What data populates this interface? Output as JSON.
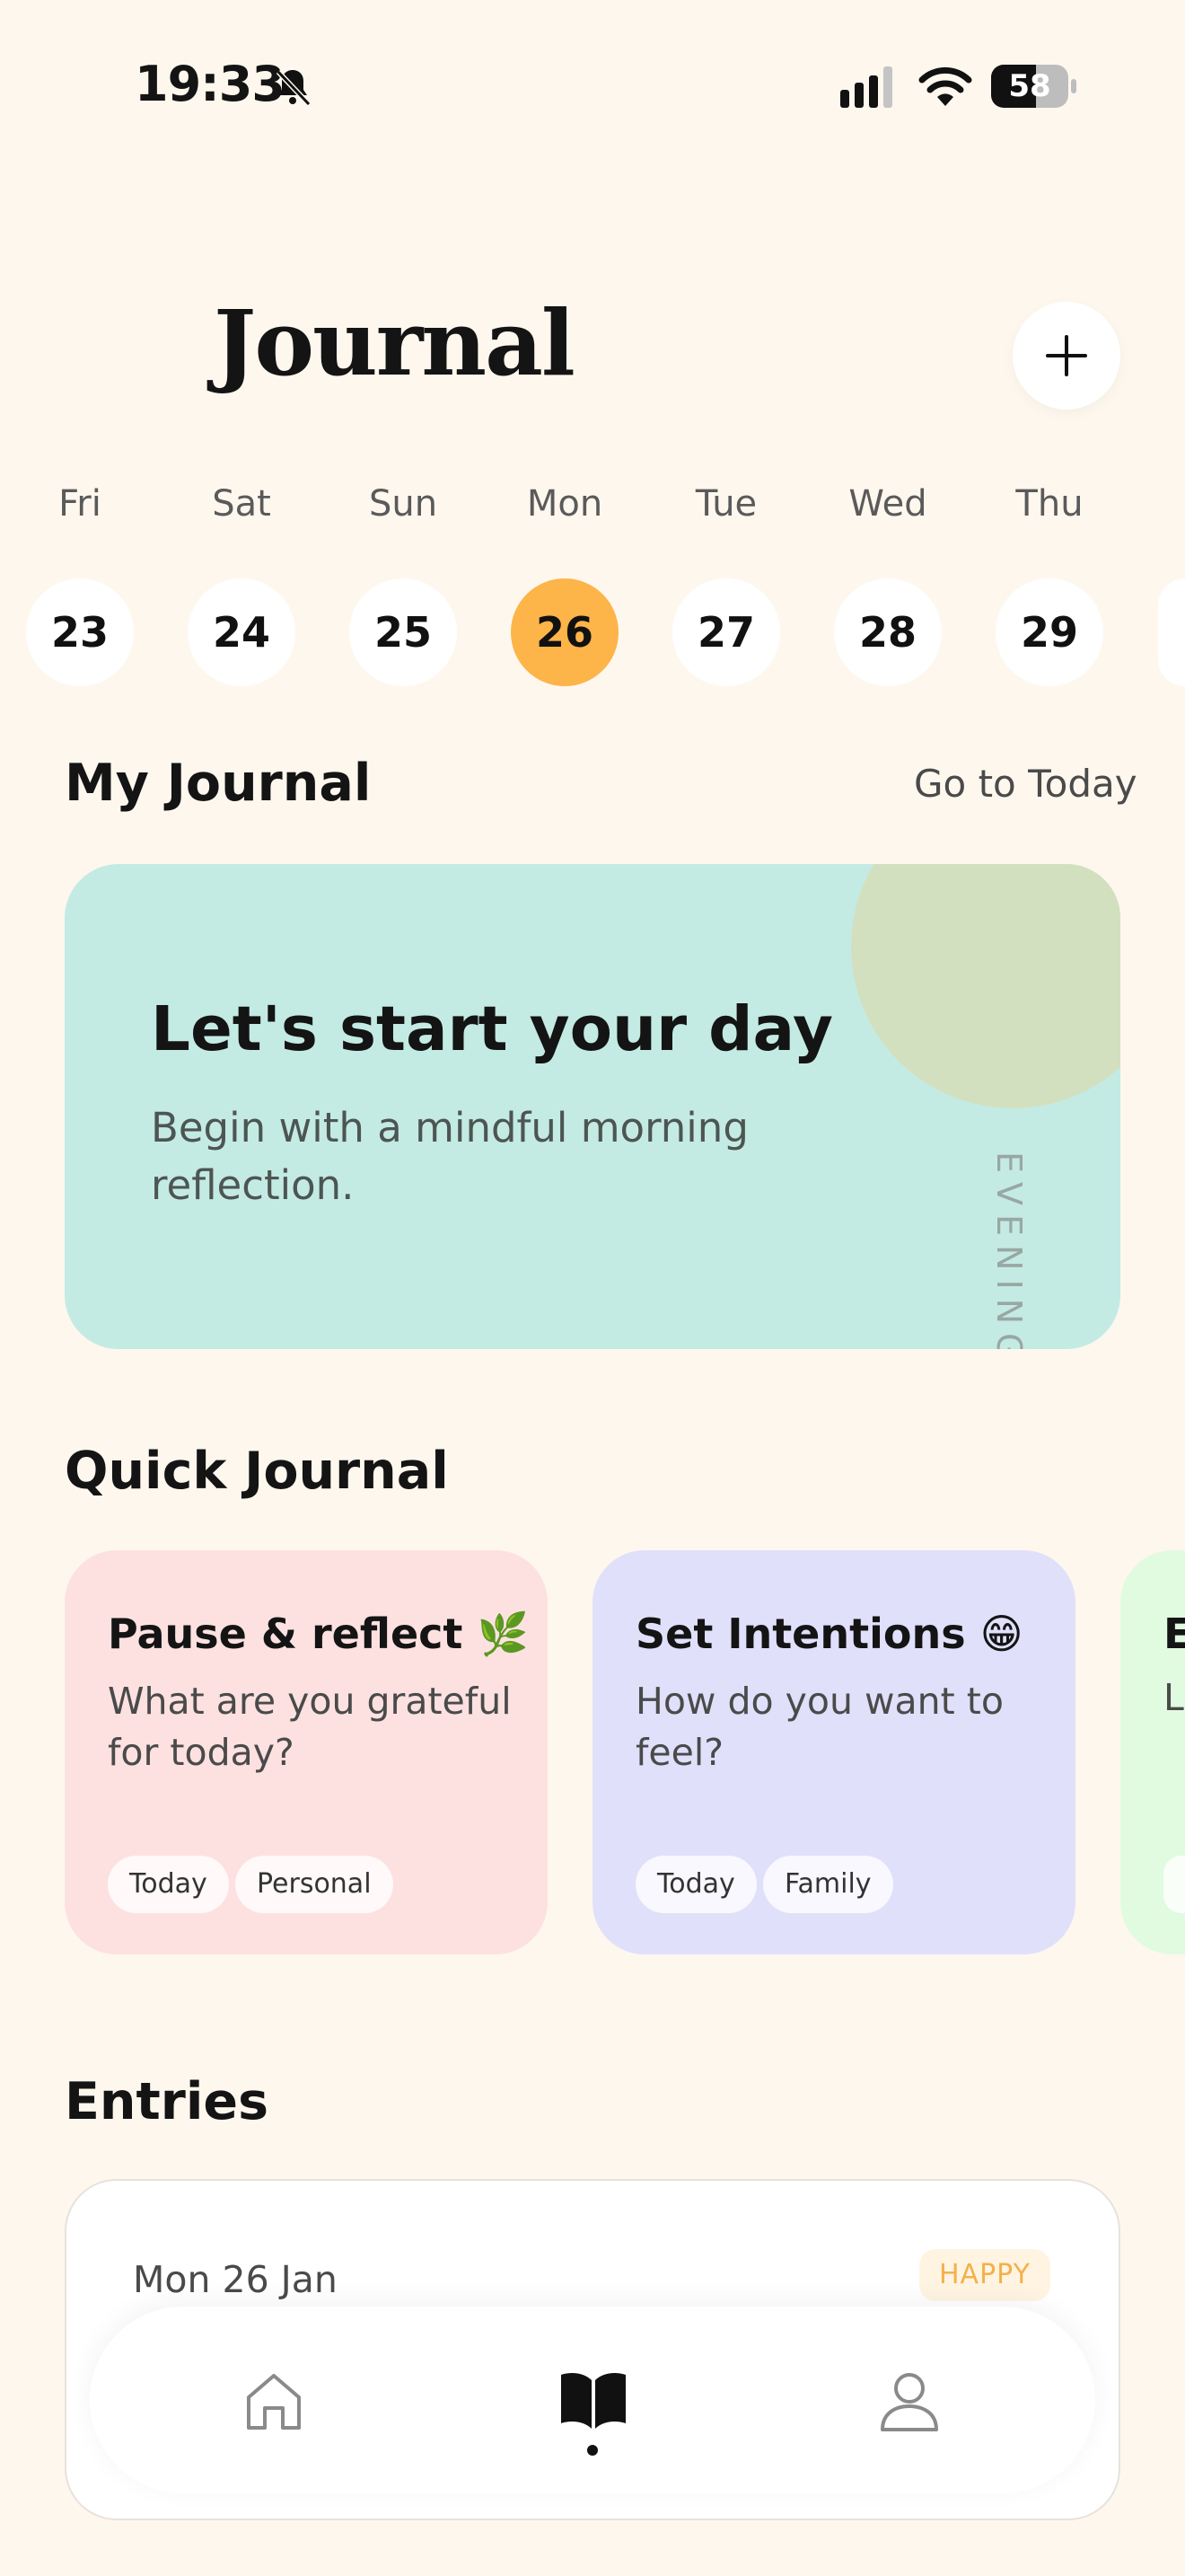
{
  "status_bar": {
    "time": "19:33",
    "battery": "58"
  },
  "header": {
    "title": "Journal"
  },
  "week": [
    {
      "day": "Fri",
      "date": "23"
    },
    {
      "day": "Sat",
      "date": "24"
    },
    {
      "day": "Sun",
      "date": "25"
    },
    {
      "day": "Mon",
      "date": "26"
    },
    {
      "day": "Tue",
      "date": "27"
    },
    {
      "day": "Wed",
      "date": "28"
    },
    {
      "day": "Thu",
      "date": "29"
    }
  ],
  "my_journal": {
    "title": "My Journal",
    "link": "Go to Today",
    "card": {
      "title": "Let's start your day",
      "subtitle": "Begin with a mindful morning reflection.",
      "vertical_label": "EVENING"
    }
  },
  "quick_journal": {
    "title": "Quick Journal",
    "cards": [
      {
        "title": "Pause & reflect 🌿",
        "subtitle": "What are you grateful for today?",
        "tags": [
          "Today",
          "Personal"
        ],
        "color": "#FDE1E1"
      },
      {
        "title": "Set Intentions 😁",
        "subtitle": "How do you want to feel?",
        "tags": [
          "Today",
          "Family"
        ],
        "color": "#E0E0FB"
      },
      {
        "title": "E",
        "subtitle": "L",
        "tags": [
          ""
        ],
        "color": "#E1FBE1"
      }
    ]
  },
  "entries": {
    "title": "Entries",
    "items": [
      {
        "date": "Mon 26 Jan",
        "mood": "HAPPY"
      }
    ]
  },
  "nav": {
    "items": [
      "home-icon",
      "book-icon",
      "profile-icon"
    ],
    "active": "book-icon"
  },
  "colors": {
    "accent": "#FDB448",
    "background": "#FEF7EE",
    "hero": "#C3EBE4"
  }
}
